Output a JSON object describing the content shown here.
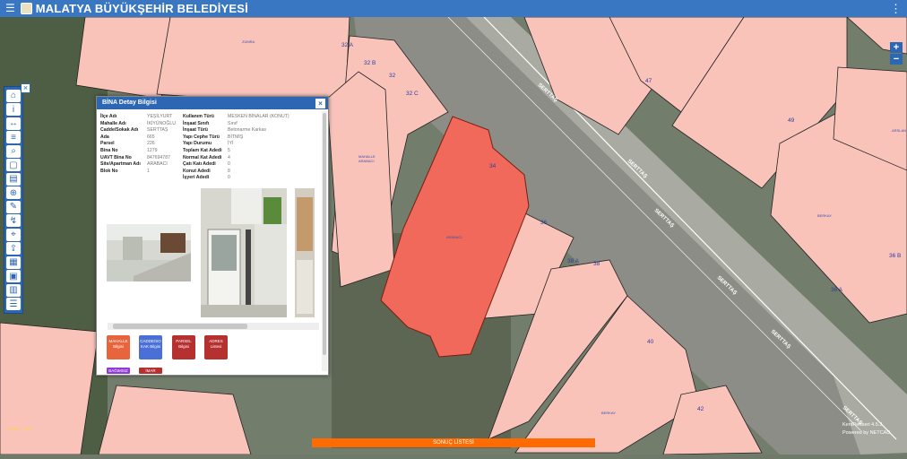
{
  "app": {
    "title": "MALATYA BÜYÜKŞEHİR BELEDİYESİ"
  },
  "toolbar": {
    "close_icon": "×",
    "tools": [
      "home-icon",
      "info-icon",
      "measure-icon",
      "layer-icon",
      "search-icon",
      "parcel-icon",
      "print-icon",
      "zoom-icon",
      "draw-icon",
      "route-icon",
      "coordinate-icon",
      "share-icon",
      "street-icon",
      "print-map-icon",
      "building-icon",
      "list-icon"
    ]
  },
  "zoom": {
    "in_label": "+",
    "out_label": "−"
  },
  "panel": {
    "title": "BİNA Detay Bilgisi",
    "close_label": "×",
    "left_fields": [
      {
        "label": "İlçe Adı",
        "value": "YEŞİLYURT"
      },
      {
        "label": "Mahalle Adı",
        "value": "İKİYÜNOĞLU"
      },
      {
        "label": "Cadde/Sokak Adı",
        "value": "SERTTAŞ"
      },
      {
        "label": "Ada",
        "value": "665"
      },
      {
        "label": "Parsel",
        "value": "226"
      },
      {
        "label": "Bina No",
        "value": "1279"
      },
      {
        "label": "UAVT Bina No",
        "value": "847694787"
      },
      {
        "label": "Site/Apartman Adı",
        "value": "ARABACI"
      },
      {
        "label": "Blok No",
        "value": "1"
      }
    ],
    "right_fields": [
      {
        "label": "Kullanım Türü",
        "value": "MESKEN BİNALAR (KONUT)"
      },
      {
        "label": "İnşaat Sınıfı",
        "value": "Sınıf"
      },
      {
        "label": "İnşaat Türü",
        "value": "Betonarme Karkas"
      },
      {
        "label": "Yapı Cephe Türü",
        "value": "BİTMİŞ"
      },
      {
        "label": "Yapı Durumu",
        "value": "İYİ"
      },
      {
        "label": "Toplam Kat Adedi",
        "value": "5"
      },
      {
        "label": "Normal Kat Adedi",
        "value": "4"
      },
      {
        "label": "Çatı Katı Adedi",
        "value": "0"
      },
      {
        "label": "Konut Adedi",
        "value": "8"
      },
      {
        "label": "İşyeri Adedi",
        "value": "0"
      }
    ],
    "buttons": [
      {
        "label": "MAHALLE Bilgisi",
        "color": "#e8643c"
      },
      {
        "label": "CADDE/SO KAK Bilgisi",
        "color": "#4a6fd6"
      },
      {
        "label": "PARSEL Bilgisi",
        "color": "#b5302e"
      },
      {
        "label": "ADRES Listesi",
        "color": "#b5302e"
      }
    ],
    "buttons_small": [
      {
        "label": "BAĞIMSIZ",
        "color": "#8f3ad6"
      },
      {
        "label": "İMAR",
        "color": "#b5302e"
      }
    ]
  },
  "map_labels": {
    "parcel_numbers": [
      "32 A",
      "32 B",
      "32",
      "32 C",
      "34",
      "36",
      "38 A",
      "38",
      "40",
      "42",
      "47",
      "49",
      "36 B",
      "36 A"
    ],
    "street_names": [
      "SERTTAŞ",
      "SERTTAŞ",
      "SERTTAŞ",
      "SERTTAŞ",
      "SERTTAŞ",
      "SERTTAŞ",
      "SERTTAŞ"
    ],
    "building_names": [
      "ZÜMRA",
      "MAHALLE ARABACI",
      "ARABACI",
      "BERKAY",
      "BERKAY",
      "ARSLAN",
      "EKİZ"
    ]
  },
  "footer": {
    "result_list_label": "SONUÇ LİSTESİ",
    "scale_text": "Ölçek 1: 387",
    "version_text": "KentRehberi 4.5.3",
    "powered_text": "Powered by NETCAD"
  },
  "colors": {
    "header": "#3a77c3",
    "selected_building": "#f0695a",
    "building": "#f9c3ba",
    "result_bar": "#ff6b00"
  }
}
